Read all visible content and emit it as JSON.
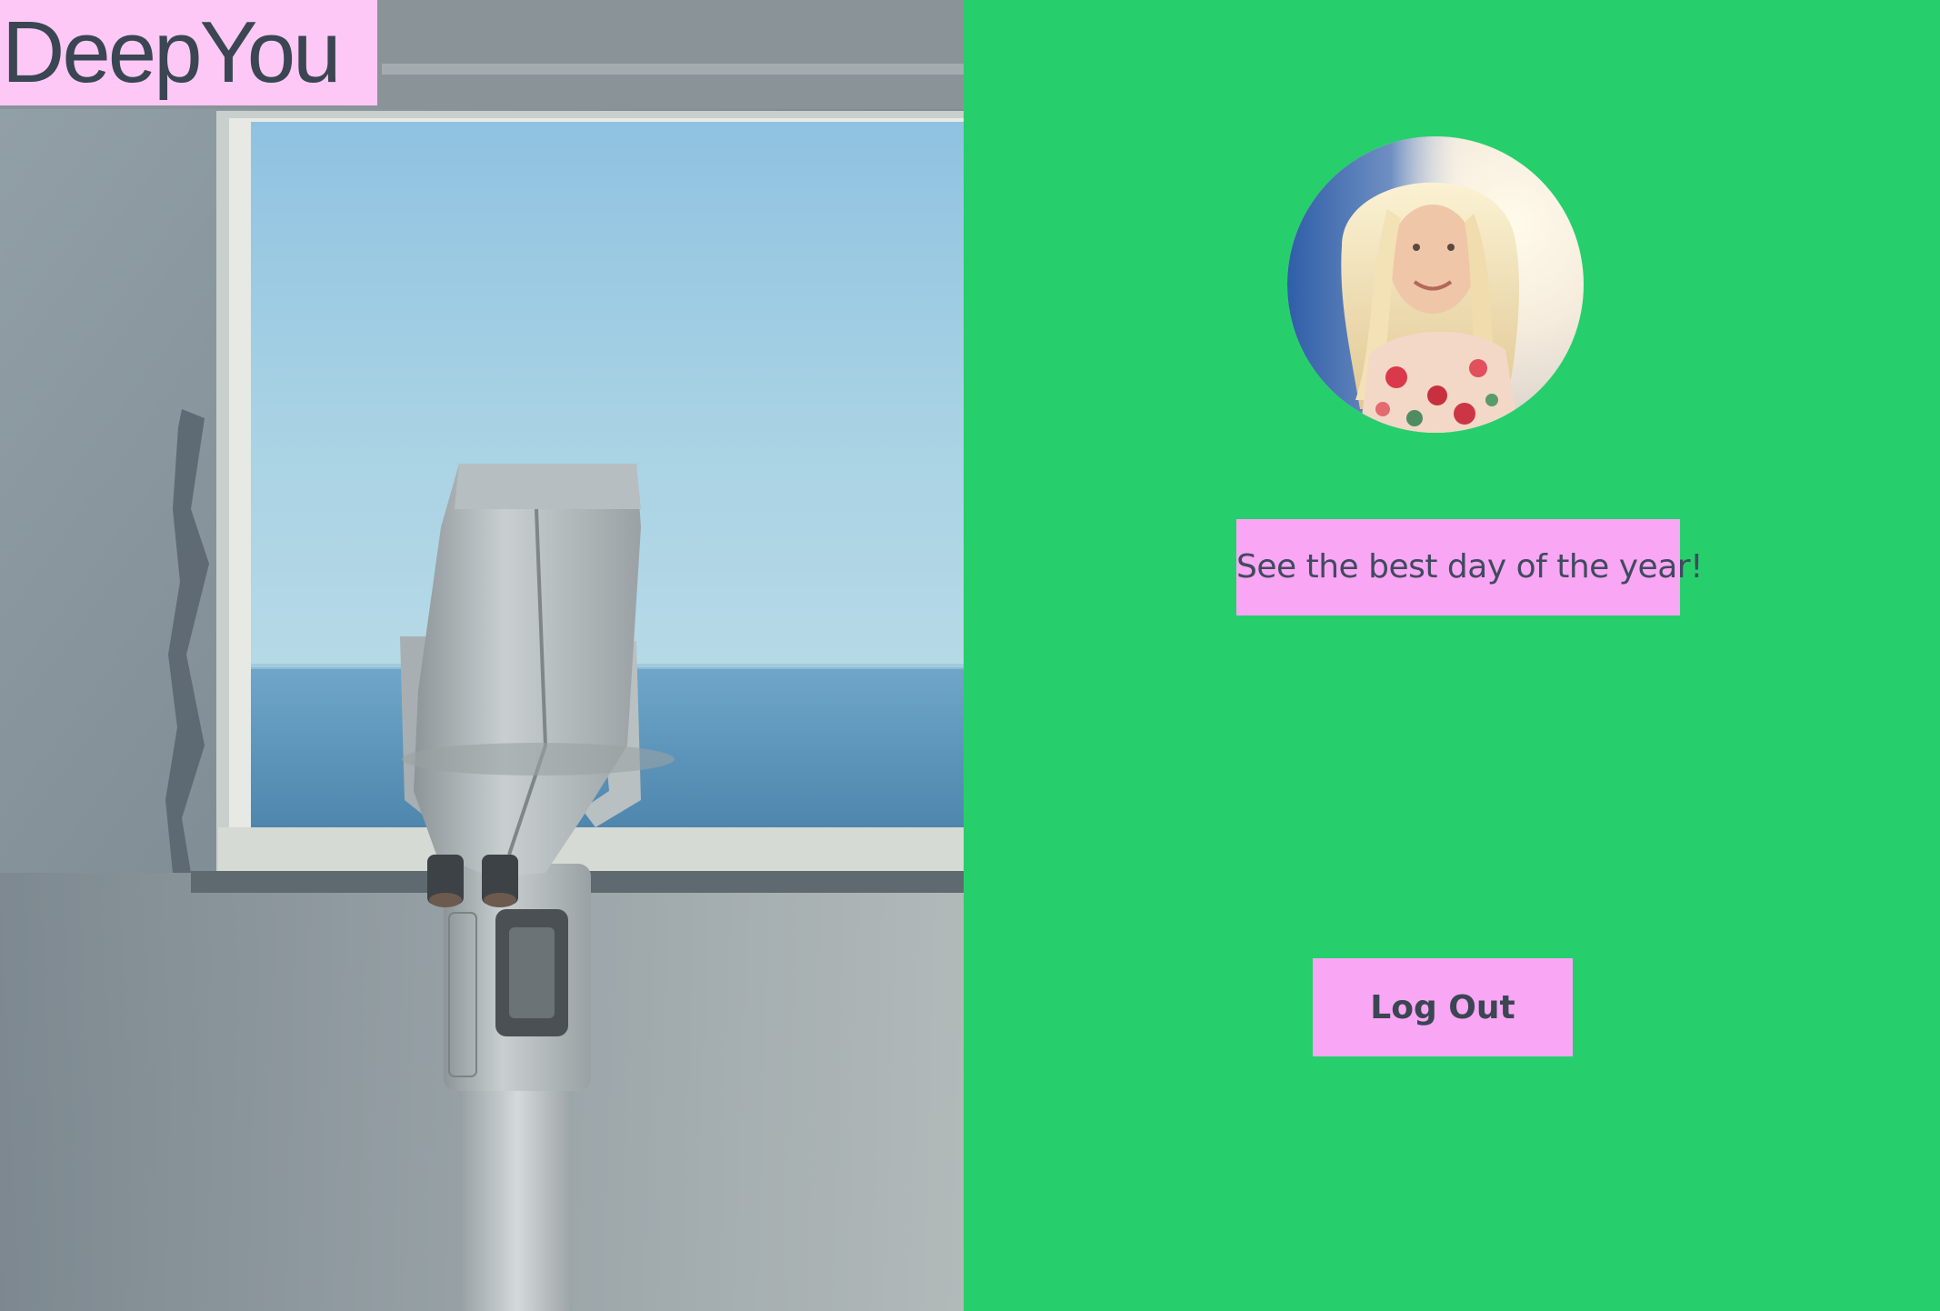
{
  "brand": {
    "name": "DeepYou"
  },
  "hero": {
    "image": "coin-binoculars-by-sea-window-photo"
  },
  "profile": {
    "avatar": "profile-photo-smiling-blonde-woman"
  },
  "tagline": {
    "text": "See the best day of the year!"
  },
  "actions": {
    "logout_label": "Log Out"
  },
  "colors": {
    "brand_background": "#fec8f6",
    "panel_background": "#27cf6c",
    "button_background": "#f9a6f4",
    "text": "#3a4652"
  }
}
